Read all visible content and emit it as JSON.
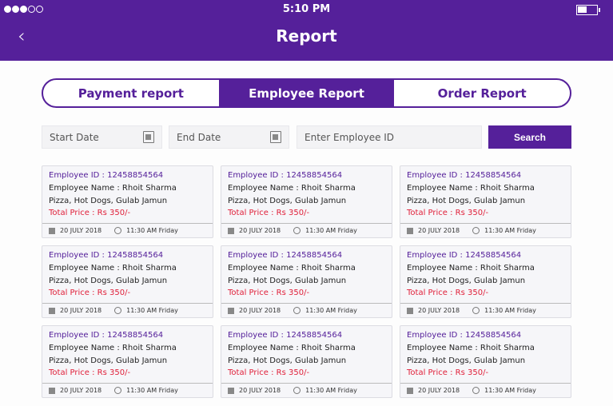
{
  "status_bar": {
    "signal_filled": 3,
    "signal_total": 5,
    "time": "5:10 PM"
  },
  "header": {
    "title": "Report",
    "back_icon": "chevron-left-icon"
  },
  "tabs": [
    {
      "label": "Payment report",
      "active": false
    },
    {
      "label": "Employee Report",
      "active": true
    },
    {
      "label": "Order Report",
      "active": false
    }
  ],
  "filters": {
    "start_date_placeholder": "Start Date",
    "end_date_placeholder": "End Date",
    "employee_id_placeholder": "Enter Employee ID",
    "search_label": "Search"
  },
  "cards": [
    {
      "id": "Employee ID : 12458854564",
      "name": "Employee Name : Rhoit Sharma",
      "items": "Pizza, Hot Dogs, Gulab Jamun",
      "price": "Total Price : Rs 350/-",
      "date": "20 JULY 2018",
      "time": "11:30 AM Friday"
    },
    {
      "id": "Employee ID : 12458854564",
      "name": "Employee Name : Rhoit Sharma",
      "items": "Pizza, Hot Dogs, Gulab Jamun",
      "price": "Total Price : Rs 350/-",
      "date": "20 JULY 2018",
      "time": "11:30 AM Friday"
    },
    {
      "id": "Employee ID : 12458854564",
      "name": "Employee Name : Rhoit Sharma",
      "items": "Pizza, Hot Dogs, Gulab Jamun",
      "price": "Total Price : Rs 350/-",
      "date": "20 JULY 2018",
      "time": "11:30 AM Friday"
    },
    {
      "id": "Employee ID : 12458854564",
      "name": "Employee Name : Rhoit Sharma",
      "items": "Pizza, Hot Dogs, Gulab Jamun",
      "price": "Total Price : Rs 350/-",
      "date": "20 JULY 2018",
      "time": "11:30 AM Friday"
    },
    {
      "id": "Employee ID : 12458854564",
      "name": "Employee Name : Rhoit Sharma",
      "items": "Pizza, Hot Dogs, Gulab Jamun",
      "price": "Total Price : Rs 350/-",
      "date": "20 JULY 2018",
      "time": "11:30 AM Friday"
    },
    {
      "id": "Employee ID : 12458854564",
      "name": "Employee Name : Rhoit Sharma",
      "items": "Pizza, Hot Dogs, Gulab Jamun",
      "price": "Total Price : Rs 350/-",
      "date": "20 JULY 2018",
      "time": "11:30 AM Friday"
    },
    {
      "id": "Employee ID : 12458854564",
      "name": "Employee Name : Rhoit Sharma",
      "items": "Pizza, Hot Dogs, Gulab Jamun",
      "price": "Total Price : Rs 350/-",
      "date": "20 JULY 2018",
      "time": "11:30 AM Friday"
    },
    {
      "id": "Employee ID : 12458854564",
      "name": "Employee Name : Rhoit Sharma",
      "items": "Pizza, Hot Dogs, Gulab Jamun",
      "price": "Total Price : Rs 350/-",
      "date": "20 JULY 2018",
      "time": "11:30 AM Friday"
    },
    {
      "id": "Employee ID : 12458854564",
      "name": "Employee Name : Rhoit Sharma",
      "items": "Pizza, Hot Dogs, Gulab Jamun",
      "price": "Total Price : Rs 350/-",
      "date": "20 JULY 2018",
      "time": "11:30 AM Friday"
    }
  ],
  "colors": {
    "primary": "#55209a",
    "price": "#e0203a",
    "card_bg": "#f6f6f9"
  }
}
